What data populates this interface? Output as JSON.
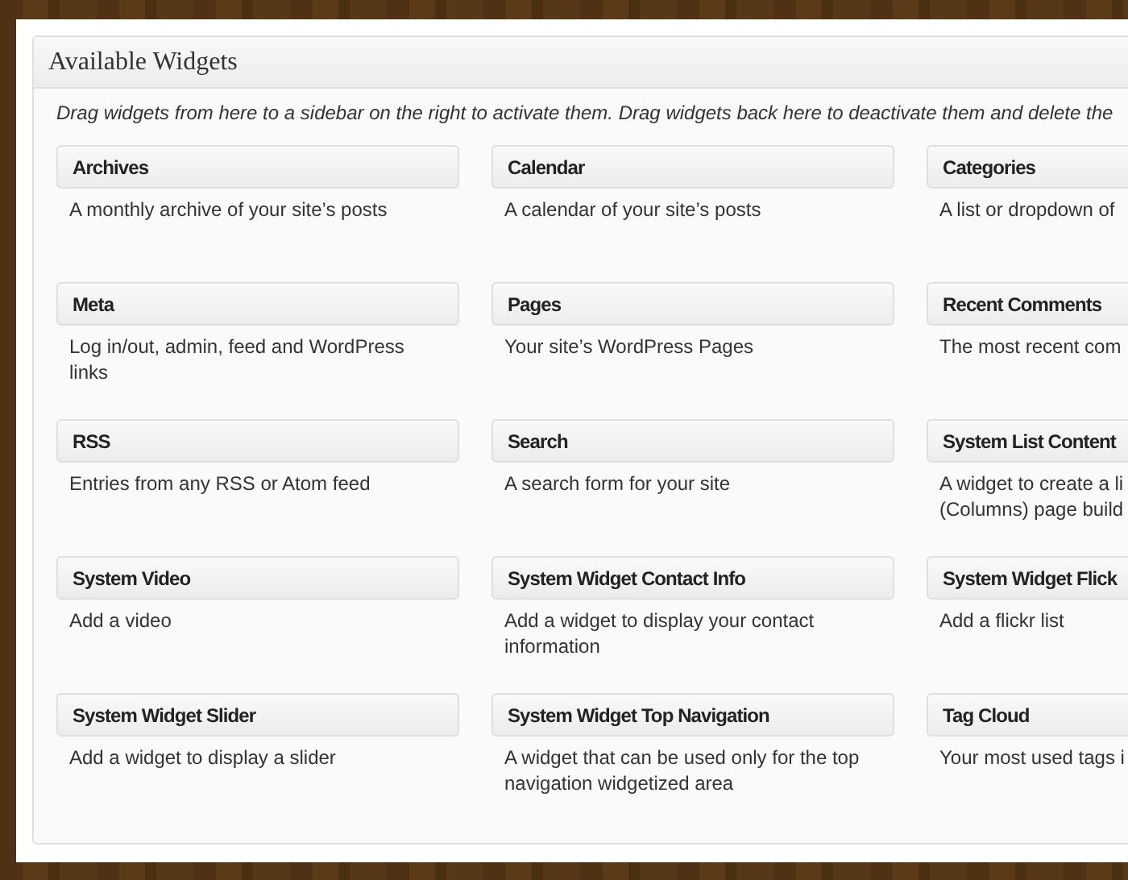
{
  "panel": {
    "title": "Available Widgets",
    "intro": "Drag widgets from here to a sidebar on the right to activate them. Drag widgets back here to deactivate them and delete the"
  },
  "widgets": [
    {
      "title": "Archives",
      "description": [
        "A monthly archive of your site’s posts"
      ]
    },
    {
      "title": "Calendar",
      "description": [
        "A calendar of your site’s posts"
      ]
    },
    {
      "title": "Categories",
      "description": [
        "A list or dropdown of"
      ]
    },
    {
      "title": "Meta",
      "description": [
        "Log in/out, admin, feed and WordPress",
        "links"
      ]
    },
    {
      "title": "Pages",
      "description": [
        "Your site’s WordPress Pages"
      ]
    },
    {
      "title": "Recent Comments",
      "description": [
        "The most recent com"
      ]
    },
    {
      "title": "RSS",
      "description": [
        "Entries from any RSS or Atom feed"
      ]
    },
    {
      "title": "Search",
      "description": [
        "A search form for your site"
      ]
    },
    {
      "title": "System List Content",
      "description": [
        "A widget to create a li",
        "(Columns) page build"
      ]
    },
    {
      "title": "System Video",
      "description": [
        "Add a video"
      ]
    },
    {
      "title": "System Widget Contact Info",
      "description": [
        "Add a widget to display your contact",
        "information"
      ]
    },
    {
      "title": "System Widget Flick",
      "description": [
        "Add a flickr list"
      ]
    },
    {
      "title": "System Widget Slider",
      "description": [
        "Add a widget to display a slider"
      ]
    },
    {
      "title": "System Widget Top Navigation",
      "description": [
        "A widget that can be used only for the top",
        "navigation widgetized area"
      ]
    },
    {
      "title": "Tag Cloud",
      "description": [
        "Your most used tags i"
      ]
    }
  ]
}
